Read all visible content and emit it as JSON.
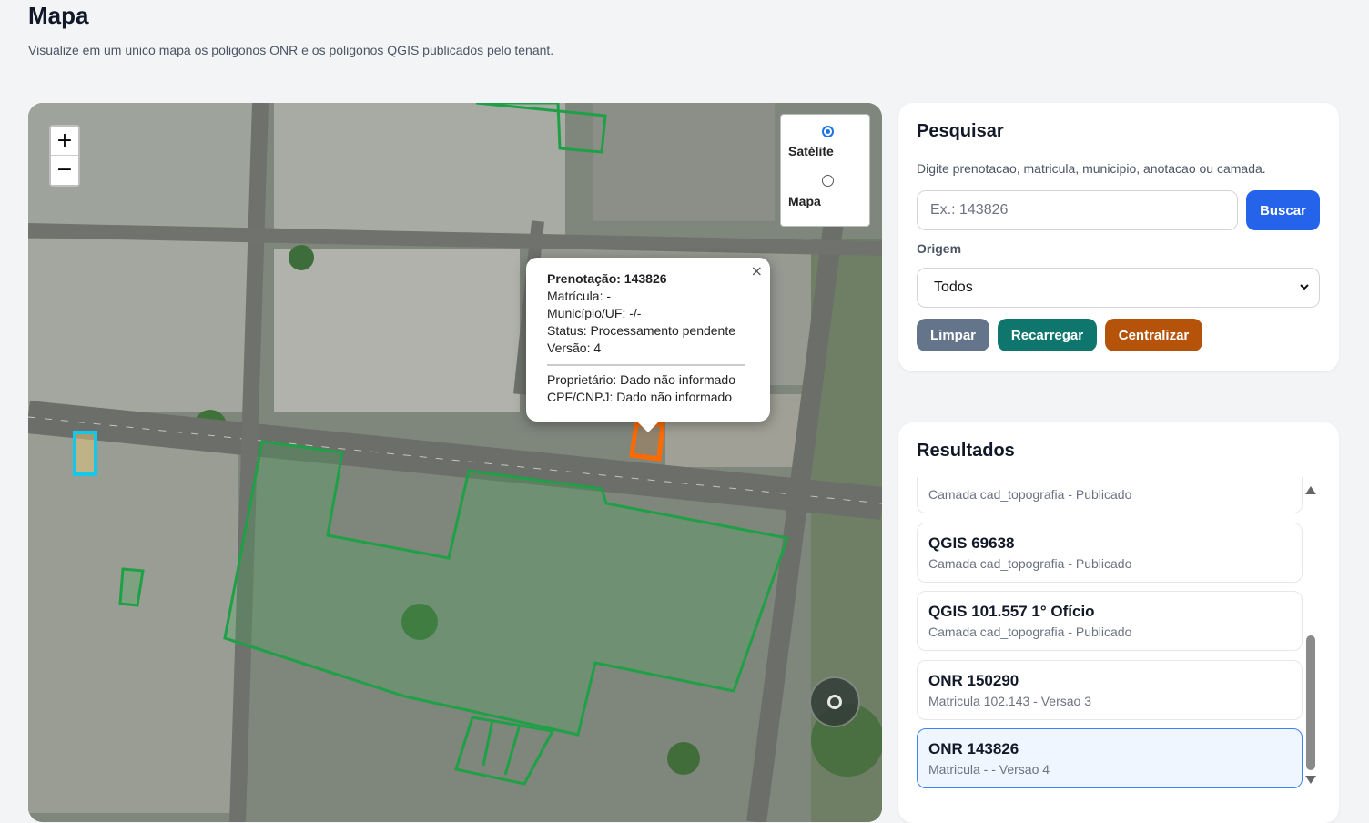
{
  "page": {
    "title": "Mapa",
    "subtitle": "Visualize em um unico mapa os poligonos ONR e os poligonos QGIS publicados pelo tenant."
  },
  "map": {
    "zoom_in": "+",
    "zoom_out": "−",
    "layers": [
      {
        "label": "Satélite",
        "selected": true
      },
      {
        "label": "Mapa",
        "selected": false
      }
    ],
    "popup": {
      "close": "×",
      "title": "Prenotação: 143826",
      "lines": [
        "Matrícula: -",
        "Município/UF: -/-",
        "Status: Processamento pendente",
        "Versão: 4"
      ],
      "owner_lines": [
        "Proprietário: Dado não informado",
        "CPF/CNPJ: Dado não informado"
      ]
    },
    "colors": {
      "qgis_polygon": "#1fa047",
      "onr_selected": "#ff6a00",
      "onr_other": "#16c8e8"
    }
  },
  "search": {
    "title": "Pesquisar",
    "help": "Digite prenotacao, matricula, municipio, anotacao ou camada.",
    "placeholder": "Ex.: 143826",
    "value": "",
    "search_button": "Buscar",
    "origin_label": "Origem",
    "origin_value": "Todos",
    "clear_button": "Limpar",
    "reload_button": "Recarregar",
    "center_button": "Centralizar"
  },
  "results": {
    "title": "Resultados",
    "items": [
      {
        "title": "",
        "subtitle": "Camada cad_topografia - Publicado",
        "selected": false
      },
      {
        "title": "QGIS 69638",
        "subtitle": "Camada cad_topografia - Publicado",
        "selected": false
      },
      {
        "title": "QGIS 101.557 1° Ofício",
        "subtitle": "Camada cad_topografia - Publicado",
        "selected": false
      },
      {
        "title": "ONR 150290",
        "subtitle": "Matricula 102.143 - Versao 3",
        "selected": false
      },
      {
        "title": "ONR 143826",
        "subtitle": "Matricula - - Versao 4",
        "selected": true
      }
    ]
  }
}
